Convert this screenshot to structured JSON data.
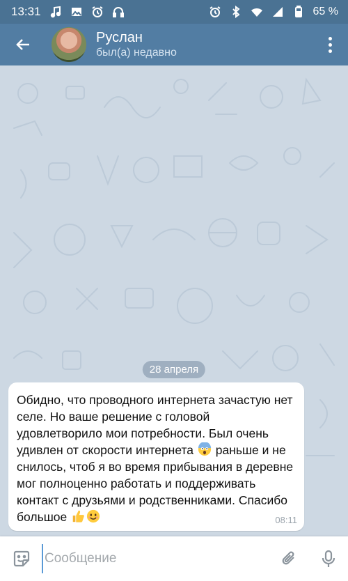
{
  "status_bar": {
    "time": "13:31",
    "battery": "65 %",
    "left_icons": [
      "music-note-icon",
      "image-icon",
      "alarm-icon",
      "headphones-icon"
    ],
    "right_icons": [
      "alarm-icon",
      "bluetooth-icon",
      "wifi-icon",
      "signal-icon",
      "battery-icon"
    ]
  },
  "header": {
    "contact_name": "Руслан",
    "contact_status": "был(а) недавно"
  },
  "chat": {
    "date_label": "28 апреля",
    "message": {
      "text_part1": "Обидно, что проводного интернета зачастую нет селе. Но ваше решение с головой удовлетворило мои потребности. Был очень удивлен от скорости интернета ",
      "emoji1": "scream-emoji",
      "text_part2": " раньше и не снилось, чтоб я во время прибывания в деревне мог полноценно работать и поддерживать контакт с друзьями и родственниками. Спасибо большое ",
      "emoji2": "thumbs-up-emoji",
      "emoji3": "smile-emoji",
      "time": "08:11"
    }
  },
  "input": {
    "placeholder": "Сообщение"
  },
  "colors": {
    "status_bar": "#4a7293",
    "header": "#527da3",
    "chat_background": "#cdd8e3",
    "bubble": "#ffffff"
  }
}
